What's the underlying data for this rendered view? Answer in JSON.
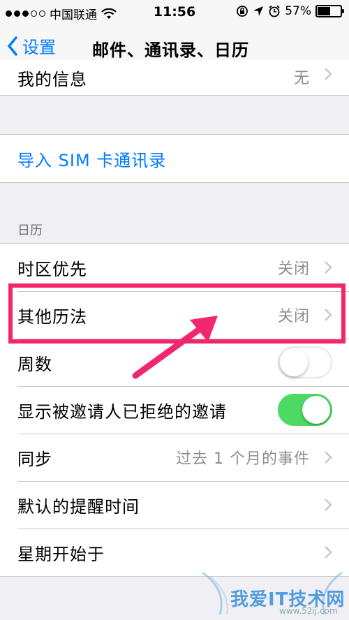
{
  "status_bar": {
    "carrier": "中国联通",
    "time": "11:56",
    "battery": "57%",
    "battery_level": 0.57,
    "icons": [
      "signal-dots-icon",
      "wifi-icon",
      "lock-rotation-icon",
      "location-icon",
      "alarm-icon",
      "battery-icon"
    ]
  },
  "nav": {
    "back_label": "设置",
    "title": "邮件、通讯录、日历"
  },
  "top_row": {
    "label": "我的信息",
    "value": "无"
  },
  "import_row": {
    "label": "导入 SIM 卡通讯录"
  },
  "calendar": {
    "header": "日历",
    "rows": [
      {
        "label": "时区优先",
        "value": "关闭",
        "control": "chevron"
      },
      {
        "label": "其他历法",
        "value": "关闭",
        "control": "chevron"
      },
      {
        "label": "周数",
        "control": "toggle",
        "on": false
      },
      {
        "label": "显示被邀请人已拒绝的邀请",
        "control": "toggle",
        "on": true
      },
      {
        "label": "同步",
        "value": "过去 1 个月的事件",
        "control": "chevron"
      },
      {
        "label": "默认的提醒时间",
        "control": "chevron"
      },
      {
        "label": "星期开始于",
        "control": "chevron"
      }
    ]
  },
  "watermark": {
    "text": "我爱IT技术网",
    "sub": "www.52ij.com"
  },
  "colors": {
    "accent": "#007aff",
    "toggle_on": "#4cd964",
    "highlight": "#f0266f",
    "background": "#efeff4"
  }
}
